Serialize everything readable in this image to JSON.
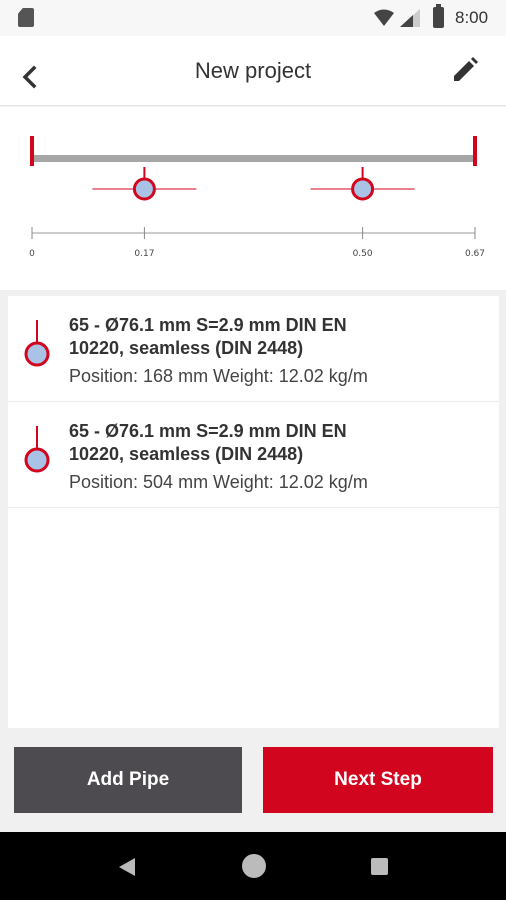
{
  "status_bar": {
    "time": "8:00",
    "icons": [
      "sd-card-icon",
      "wifi-icon",
      "cell-signal-icon",
      "battery-icon"
    ]
  },
  "app_bar": {
    "title": "New project",
    "back_icon": "chevron-left-icon",
    "edit_icon": "pencil-icon"
  },
  "diagram": {
    "beam_color": "#a6a6a6",
    "accent_color": "#d2051e",
    "pipe_fill": "#a8c3e6",
    "scale_max": 0.67,
    "ticks": [
      "0",
      "0.17",
      "0.50",
      "0.67"
    ],
    "pipe_positions": [
      0.17,
      0.5
    ]
  },
  "pipes": [
    {
      "title_line1": "65 - Ø76.1 mm S=2.9 mm DIN EN",
      "title_line2": "10220, seamless (DIN 2448)",
      "details": "Position: 168 mm Weight: 12.02 kg/m"
    },
    {
      "title_line1": "65 - Ø76.1 mm S=2.9 mm DIN EN",
      "title_line2": "10220, seamless (DIN 2448)",
      "details": "Position: 504 mm Weight: 12.02 kg/m"
    }
  ],
  "actions": {
    "add_pipe": "Add Pipe",
    "next_step": "Next Step"
  },
  "nav_bar": {
    "icons": [
      "back-triangle-icon",
      "home-circle-icon",
      "recents-square-icon"
    ]
  }
}
